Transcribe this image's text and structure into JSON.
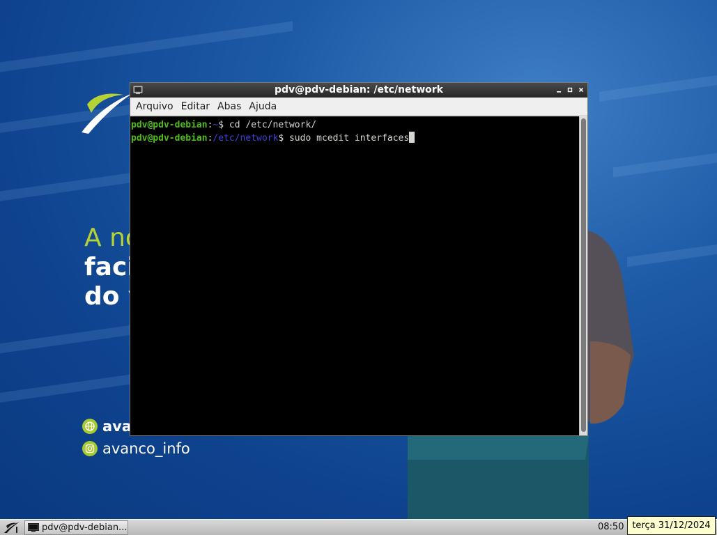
{
  "wallpaper": {
    "headline_1": "A no",
    "headline_2": "faci",
    "headline_3": "do v",
    "social_site": "avan",
    "social_instagram": "avanco_info",
    "accent_color": "#b5d334"
  },
  "window": {
    "title": "pdv@pdv-debian: /etc/network",
    "controls": {
      "minimize": "–",
      "maximize": "□",
      "close": "×"
    },
    "menu": [
      "Arquivo",
      "Editar",
      "Abas",
      "Ajuda"
    ],
    "terminal": {
      "lines": [
        {
          "user": "pdv@pdv-debian",
          "sep": ":",
          "dir": "~",
          "prompt": "$ ",
          "command": "cd /etc/network/"
        },
        {
          "user": "pdv@pdv-debian",
          "sep": ":",
          "dir": "/etc/network",
          "prompt": "$ ",
          "command": "sudo mcedit interfaces"
        }
      ],
      "colors": {
        "user": "#4fbd1b",
        "dir": "#3a43d6",
        "background": "#000000"
      }
    }
  },
  "taskbar": {
    "task_label": "pdv@pdv-debian...",
    "clock": "08:50",
    "date_tooltip": "terça 31/12/2024"
  }
}
